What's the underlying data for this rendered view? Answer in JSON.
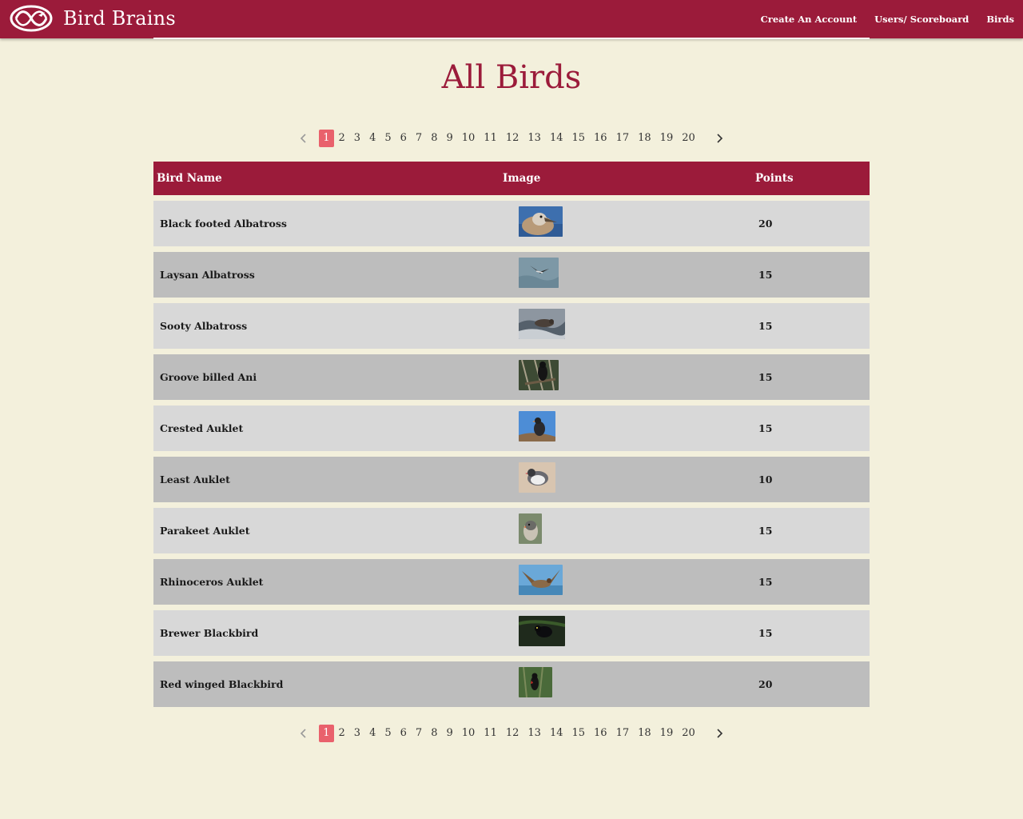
{
  "brand": {
    "name": "Bird Brains",
    "logo_icon": "bird-logo-icon"
  },
  "nav": {
    "items": [
      {
        "label": "Create An Account"
      },
      {
        "label": "Users/ Scoreboard"
      },
      {
        "label": "Birds"
      }
    ]
  },
  "page": {
    "title": "All Birds"
  },
  "pagination": {
    "current": 1,
    "pages": [
      "1",
      "2",
      "3",
      "4",
      "5",
      "6",
      "7",
      "8",
      "9",
      "10",
      "11",
      "12",
      "13",
      "14",
      "15",
      "16",
      "17",
      "18",
      "19",
      "20"
    ],
    "prev_icon": "chevron-left-icon",
    "next_icon": "chevron-right-icon"
  },
  "table": {
    "headers": {
      "name": "Bird Name",
      "image": "Image",
      "points": "Points"
    },
    "rows": [
      {
        "name": "Black footed Albatross",
        "points": "20"
      },
      {
        "name": "Laysan Albatross",
        "points": "15"
      },
      {
        "name": "Sooty Albatross",
        "points": "15"
      },
      {
        "name": "Groove billed Ani",
        "points": "15"
      },
      {
        "name": "Crested Auklet",
        "points": "15"
      },
      {
        "name": "Least Auklet",
        "points": "10"
      },
      {
        "name": "Parakeet Auklet",
        "points": "15"
      },
      {
        "name": "Rhinoceros Auklet",
        "points": "15"
      },
      {
        "name": "Brewer Blackbird",
        "points": "15"
      },
      {
        "name": "Red winged Blackbird",
        "points": "20"
      }
    ]
  },
  "colors": {
    "brand": "#9b1b3a",
    "background": "#f3f0dc",
    "active_page": "#e9616c",
    "row_light": "#d8d8d8",
    "row_dark": "#bdbdbd"
  }
}
